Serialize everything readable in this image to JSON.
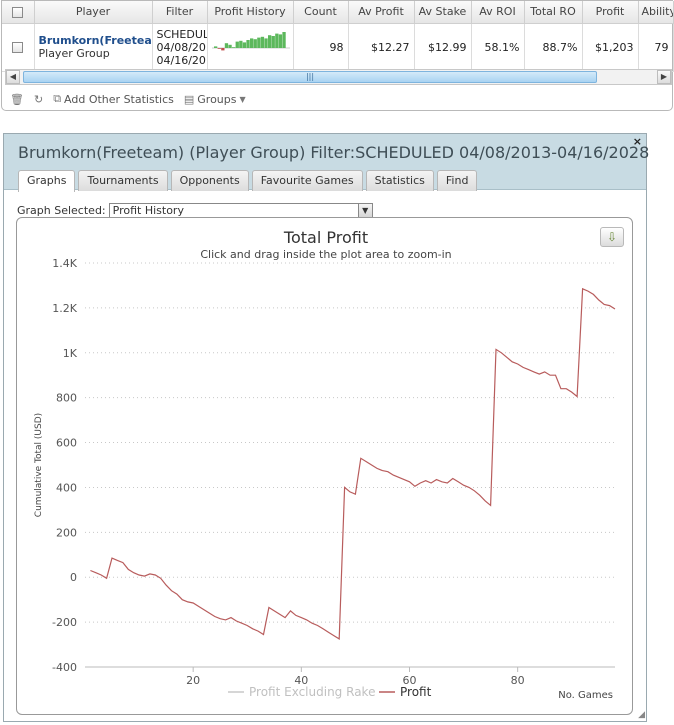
{
  "grid": {
    "columns": [
      "",
      "Player",
      "Filter",
      "Profit History",
      "Count",
      "Av Profit",
      "Av Stake",
      "Av ROI",
      "Total RO",
      "Profit",
      "Ability"
    ],
    "row": {
      "player_name": "Brumkorn(Freetean",
      "player_sub": "Player Group",
      "filter_lines": [
        "SCHEDUL",
        "04/08/20",
        "04/16/20"
      ],
      "count": "98",
      "av_profit": "$12.27",
      "av_stake": "$12.99",
      "av_roi": "58.1%",
      "total_roi": "88.7%",
      "profit": "$1,203",
      "ability": "79"
    },
    "sparkline": [
      2,
      -1,
      -3,
      6,
      4,
      1,
      8,
      9,
      7,
      10,
      12,
      11,
      13,
      14,
      12,
      16,
      15,
      18,
      17,
      20
    ],
    "toolbar": {
      "add_stats": "Add Other Statistics",
      "groups": "Groups"
    }
  },
  "dialog": {
    "title": "Brumkorn(Freeteam) (Player Group) Filter:SCHEDULED 04/08/2013-04/16/2028",
    "close_glyph": "×",
    "tabs": [
      "Graphs",
      "Tournaments",
      "Opponents",
      "Favourite Games",
      "Statistics",
      "Find"
    ],
    "active_tab": 0,
    "graph_select_label": "Graph Selected:",
    "graph_select_value": "Profit History"
  },
  "colors": {
    "profit": "#b85c5c",
    "excl_rake": "#c8c8c8",
    "spark_green": "#5cb85c",
    "spark_red": "#c0504d"
  },
  "chart_data": {
    "type": "line",
    "title": "Total Profit",
    "subtitle": "Click and drag inside the plot area to zoom-in",
    "xlabel": "No. Games",
    "ylabel": "Cumulative Total (USD)",
    "xlim": [
      0,
      98
    ],
    "ylim": [
      -400,
      1400
    ],
    "yticks": [
      -400,
      -200,
      0,
      200,
      400,
      600,
      800,
      1000,
      1200,
      1400
    ],
    "ytick_labels": [
      "-400",
      "-200",
      "0",
      "200",
      "400",
      "600",
      "800",
      "1K",
      "1.2K",
      "1.4K"
    ],
    "xticks": [
      20,
      40,
      60,
      80
    ],
    "grid": "horizontal dotted",
    "legend": {
      "placement": "bottom-center",
      "entries": [
        "Profit Excluding Rake",
        "Profit"
      ]
    },
    "series": [
      {
        "name": "Profit",
        "x": [
          1,
          2,
          3,
          4,
          5,
          6,
          7,
          8,
          9,
          10,
          11,
          12,
          13,
          14,
          15,
          16,
          17,
          18,
          19,
          20,
          21,
          22,
          23,
          24,
          25,
          26,
          27,
          28,
          29,
          30,
          31,
          32,
          33,
          34,
          35,
          36,
          37,
          38,
          39,
          40,
          41,
          42,
          43,
          44,
          45,
          46,
          47,
          48,
          49,
          50,
          51,
          52,
          53,
          54,
          55,
          56,
          57,
          58,
          59,
          60,
          61,
          62,
          63,
          64,
          65,
          66,
          67,
          68,
          69,
          70,
          71,
          72,
          73,
          74,
          75,
          76,
          77,
          78,
          79,
          80,
          81,
          82,
          83,
          84,
          85,
          86,
          87,
          88,
          89,
          90,
          91,
          92,
          93,
          94,
          95,
          96,
          97,
          98
        ],
        "y": [
          30,
          20,
          10,
          -5,
          85,
          75,
          65,
          35,
          20,
          10,
          5,
          15,
          10,
          -5,
          -35,
          -60,
          -75,
          -100,
          -110,
          -115,
          -130,
          -145,
          -160,
          -175,
          -185,
          -190,
          -180,
          -195,
          -205,
          -215,
          -230,
          -240,
          -255,
          -135,
          -150,
          -165,
          -180,
          -150,
          -170,
          -180,
          -190,
          -205,
          -215,
          -230,
          -245,
          -260,
          -275,
          400,
          380,
          370,
          530,
          515,
          500,
          485,
          475,
          470,
          455,
          445,
          435,
          425,
          405,
          420,
          430,
          420,
          435,
          425,
          420,
          440,
          425,
          410,
          400,
          385,
          365,
          340,
          320,
          1015,
          1000,
          980,
          960,
          950,
          935,
          925,
          915,
          905,
          915,
          900,
          900,
          840,
          840,
          825,
          805,
          1285,
          1275,
          1260,
          1235,
          1215,
          1210,
          1195
        ]
      }
    ]
  }
}
